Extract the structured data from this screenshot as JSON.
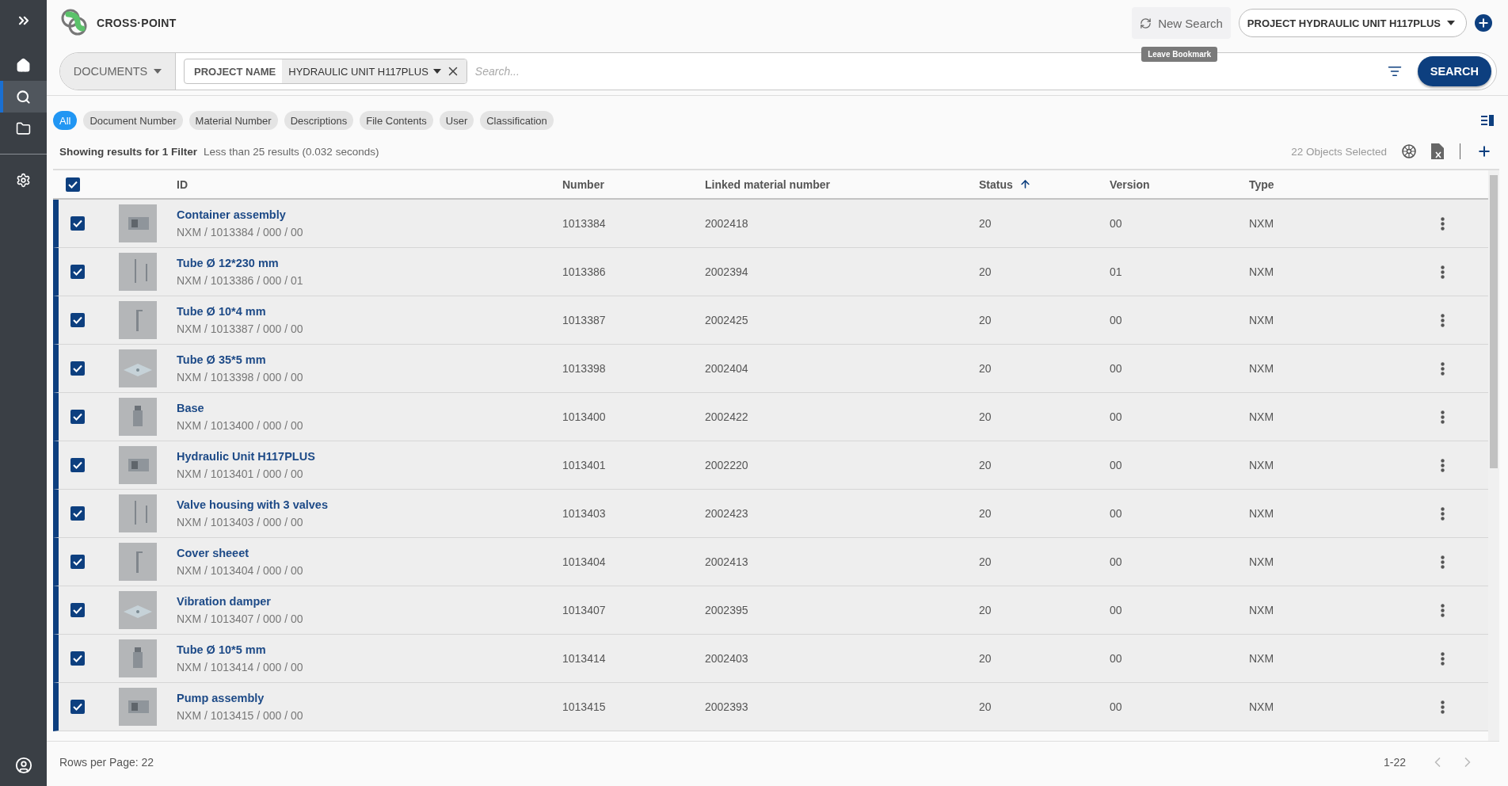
{
  "sidebar": {
    "items": [
      {
        "kind": "home",
        "selected": false
      },
      {
        "kind": "search",
        "selected": true
      },
      {
        "kind": "folder",
        "selected": false
      },
      {
        "kind": "settings",
        "selected": false
      }
    ]
  },
  "header": {
    "brand": "CROSS·POINT",
    "new_search": "New Search",
    "tooltip": "Leave Bookmark",
    "project": "PROJECT HYDRAULIC UNIT H117PLUS"
  },
  "search": {
    "scope": "DOCUMENTS",
    "filter_label": "PROJECT NAME",
    "filter_value": "HYDRAULIC UNIT H117PLUS",
    "placeholder": "Search...",
    "button": "SEARCH"
  },
  "chips": [
    {
      "label": "All",
      "selected": true
    },
    {
      "label": "Document Number",
      "selected": false
    },
    {
      "label": "Material Number",
      "selected": false
    },
    {
      "label": "Descriptions",
      "selected": false
    },
    {
      "label": "File Contents",
      "selected": false
    },
    {
      "label": "User",
      "selected": false
    },
    {
      "label": "Classification",
      "selected": false
    }
  ],
  "results": {
    "title": "Showing results for 1 Filter",
    "summary": "Less than 25 results (0.032 seconds)",
    "selected_count": "22 Objects Selected"
  },
  "table": {
    "all_checked": true,
    "columns": [
      {
        "label": "ID",
        "sorted": false
      },
      {
        "label": "Number",
        "sorted": false
      },
      {
        "label": "Linked material number",
        "sorted": false
      },
      {
        "label": "Status",
        "sorted": true
      },
      {
        "label": "Version",
        "sorted": false
      },
      {
        "label": "Type",
        "sorted": false
      }
    ],
    "rows": [
      {
        "selected": true,
        "checked": true,
        "title": "Container assembly",
        "path": "NXM / 1013384 / 000 / 00",
        "number": "1013384",
        "linked": "2002418",
        "status": "20",
        "version": "00",
        "type": "NXM"
      },
      {
        "selected": true,
        "checked": true,
        "title": "Tube Ø 12*230 mm",
        "path": "NXM / 1013386 / 000 / 01",
        "number": "1013386",
        "linked": "2002394",
        "status": "20",
        "version": "01",
        "type": "NXM"
      },
      {
        "selected": true,
        "checked": true,
        "title": "Tube Ø 10*4 mm",
        "path": "NXM / 1013387 / 000 / 00",
        "number": "1013387",
        "linked": "2002425",
        "status": "20",
        "version": "00",
        "type": "NXM"
      },
      {
        "selected": true,
        "checked": true,
        "title": "Tube Ø 35*5 mm",
        "path": "NXM / 1013398 / 000 / 00",
        "number": "1013398",
        "linked": "2002404",
        "status": "20",
        "version": "00",
        "type": "NXM"
      },
      {
        "selected": true,
        "checked": true,
        "title": "Base",
        "path": "NXM / 1013400 / 000 / 00",
        "number": "1013400",
        "linked": "2002422",
        "status": "20",
        "version": "00",
        "type": "NXM"
      },
      {
        "selected": true,
        "checked": true,
        "title": "Hydraulic Unit H117PLUS",
        "path": "NXM / 1013401 / 000 / 00",
        "number": "1013401",
        "linked": "2002220",
        "status": "20",
        "version": "00",
        "type": "NXM"
      },
      {
        "selected": true,
        "checked": true,
        "title": "Valve housing with 3 valves",
        "path": "NXM / 1013403 / 000 / 00",
        "number": "1013403",
        "linked": "2002423",
        "status": "20",
        "version": "00",
        "type": "NXM"
      },
      {
        "selected": true,
        "checked": true,
        "title": "Cover sheeet",
        "path": "NXM / 1013404 / 000 / 00",
        "number": "1013404",
        "linked": "2002413",
        "status": "20",
        "version": "00",
        "type": "NXM"
      },
      {
        "selected": true,
        "checked": true,
        "title": "Vibration damper",
        "path": "NXM / 1013407 / 000 / 00",
        "number": "1013407",
        "linked": "2002395",
        "status": "20",
        "version": "00",
        "type": "NXM"
      },
      {
        "selected": true,
        "checked": true,
        "title": "Tube Ø 10*5 mm",
        "path": "NXM / 1013414 / 000 / 00",
        "number": "1013414",
        "linked": "2002403",
        "status": "20",
        "version": "00",
        "type": "NXM"
      },
      {
        "selected": true,
        "checked": true,
        "title": "Pump assembly",
        "path": "NXM / 1013415 / 000 / 00",
        "number": "1013415",
        "linked": "2002393",
        "status": "20",
        "version": "00",
        "type": "NXM"
      }
    ]
  },
  "footer": {
    "rows_per_page": "Rows per Page: 22",
    "range": "1-22",
    "prev_disabled": true,
    "next_disabled": true
  }
}
